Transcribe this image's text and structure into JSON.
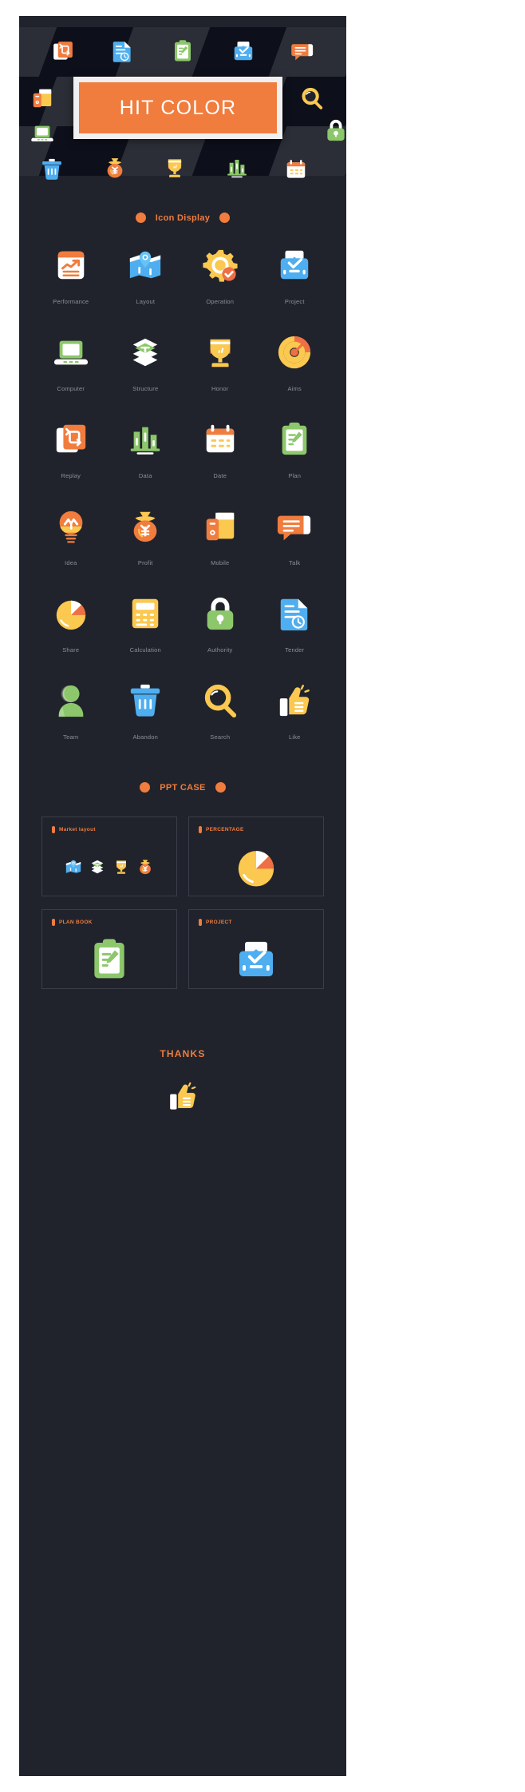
{
  "colors": {
    "page_bg": "#20232b",
    "outer_bg": "#ffffff",
    "accent": "#f07c3e",
    "banner_frame": "#f0f0f0",
    "label": "#8c8f99",
    "card_border": "#3b3e48",
    "band_dark": "#0d0f1a",
    "band_light": "#2b2e36",
    "blue": "#4eaef0",
    "green": "#8cc76b",
    "yellow": "#fbc850",
    "orange": "#f07c3e",
    "white": "#ffffff"
  },
  "hero": {
    "banner_title": "HIT COLOR",
    "row1_icons": [
      "replay-icon",
      "tender-icon",
      "plan-icon",
      "project-icon",
      "talk-icon"
    ],
    "row2_icons": [
      "mobile-icon",
      "search-icon",
      "authority-icon"
    ],
    "row3_icons": [
      "abandon-icon",
      "profit-icon",
      "honor-icon",
      "data-icon",
      "date-icon"
    ]
  },
  "sections": {
    "icon_display": {
      "title": "Icon Display"
    },
    "ppt_case": {
      "title": "PPT CASE"
    },
    "thanks": {
      "title": "THANKS",
      "icon": "like-icon"
    }
  },
  "icons": [
    {
      "label": "Performance",
      "icon": "performance-icon"
    },
    {
      "label": "Layout",
      "icon": "layout-icon"
    },
    {
      "label": "Operation",
      "icon": "operation-icon"
    },
    {
      "label": "Project",
      "icon": "project-icon"
    },
    {
      "label": "Computer",
      "icon": "computer-icon"
    },
    {
      "label": "Structure",
      "icon": "structure-icon"
    },
    {
      "label": "Honor",
      "icon": "honor-icon"
    },
    {
      "label": "Aims",
      "icon": "aims-icon"
    },
    {
      "label": "Replay",
      "icon": "replay-icon"
    },
    {
      "label": "Data",
      "icon": "data-icon"
    },
    {
      "label": "Date",
      "icon": "date-icon"
    },
    {
      "label": "Plan",
      "icon": "plan-icon"
    },
    {
      "label": "Idea",
      "icon": "idea-icon"
    },
    {
      "label": "Profit",
      "icon": "profit-icon"
    },
    {
      "label": "Mobile",
      "icon": "mobile-icon"
    },
    {
      "label": "Talk",
      "icon": "talk-icon"
    },
    {
      "label": "Share",
      "icon": "share-icon"
    },
    {
      "label": "Calculation",
      "icon": "calculation-icon"
    },
    {
      "label": "Authority",
      "icon": "authority-icon"
    },
    {
      "label": "Tender",
      "icon": "tender-icon"
    },
    {
      "label": "Team",
      "icon": "team-icon"
    },
    {
      "label": "Abandon",
      "icon": "abandon-icon"
    },
    {
      "label": "Search",
      "icon": "search-icon"
    },
    {
      "label": "Like",
      "icon": "like-icon"
    }
  ],
  "cards": [
    {
      "title": "Market layout",
      "content_icons": [
        "layout-icon",
        "structure-icon",
        "honor-icon",
        "profit-icon"
      ]
    },
    {
      "title": "PERCENTAGE",
      "content_icons": [
        "share-icon"
      ]
    },
    {
      "title": "PLAN BOOK",
      "content_icons": [
        "plan-icon"
      ]
    },
    {
      "title": "PROJECT",
      "content_icons": [
        "project-icon"
      ]
    }
  ]
}
